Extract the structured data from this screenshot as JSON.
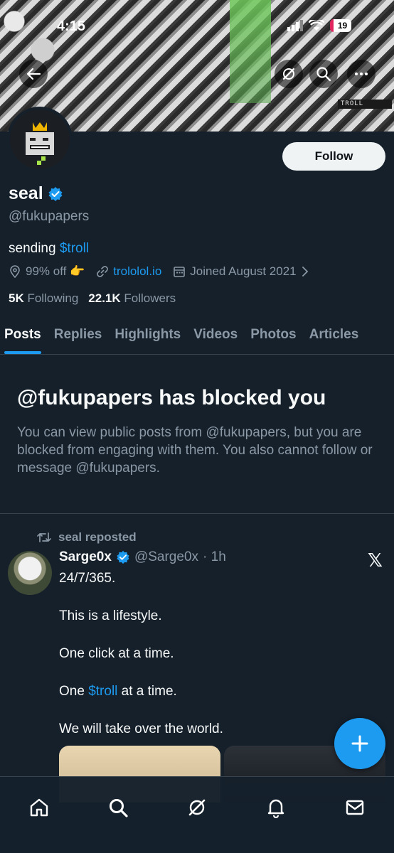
{
  "status_bar": {
    "time": "4:15",
    "battery": "19"
  },
  "banner": {
    "tag": "TROLL"
  },
  "profile": {
    "display_name": "seal",
    "handle": "@fukupapers",
    "bio_prefix": "sending ",
    "bio_link": "$troll",
    "location": "99% off 👉",
    "website": "trololol.io",
    "joined": "Joined August 2021",
    "following_count": "5K",
    "following_label": "Following",
    "followers_count": "22.1K",
    "followers_label": "Followers",
    "follow_label": "Follow"
  },
  "tabs": [
    "Posts",
    "Replies",
    "Highlights",
    "Videos",
    "Photos",
    "Articles"
  ],
  "blocked": {
    "title": "@fukupapers has blocked you",
    "text": "You can view public posts from @fukupapers, but you are blocked from engaging with them. You also cannot follow or message @fukupapers."
  },
  "post": {
    "repost_label": "seal reposted",
    "author": "Sarge0x",
    "handle": "@Sarge0x",
    "time": "· 1h",
    "lines": {
      "l1": "24/7/365.",
      "l2": "This is a lifestyle.",
      "l3": "One click at a time.",
      "l4_prefix": "One ",
      "l4_link": "$troll",
      "l4_suffix": " at a time.",
      "l5": "We will take over the world."
    }
  },
  "colors": {
    "accent": "#1d9bf0",
    "background": "#15202b",
    "muted": "#8b98a5"
  },
  "icons": [
    "back-arrow-icon",
    "grok-icon",
    "search-icon",
    "more-icon",
    "verified-badge-icon",
    "location-icon",
    "link-icon",
    "calendar-icon",
    "chevron-right-icon",
    "repost-icon",
    "x-logo-icon",
    "plus-icon",
    "home-icon",
    "bell-icon",
    "mail-icon"
  ]
}
